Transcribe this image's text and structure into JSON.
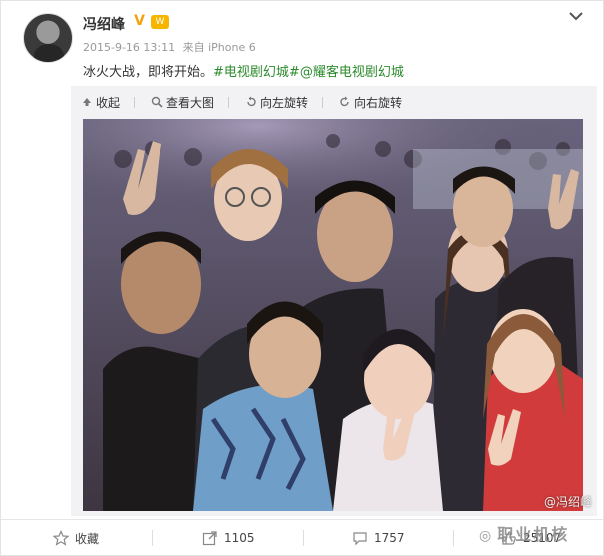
{
  "post": {
    "username": "冯绍峰",
    "verified_mark": "V",
    "level_badge": "W",
    "timestamp": "2015-9-16 13:11",
    "source": "来自 iPhone 6",
    "text_plain": "冰火大战，即将开始。",
    "tags": [
      "#电视剧幻城#",
      "@耀客电视剧幻城"
    ]
  },
  "media_toolbar": {
    "collapse": "收起",
    "view_large": "查看大图",
    "rotate_left": "向左旋转",
    "rotate_right": "向右旋转"
  },
  "photo": {
    "watermark": "@冯绍峰"
  },
  "footer": {
    "favorite_label": "收藏",
    "repost_count": "1105",
    "comment_count": "1757",
    "like_count": "25107"
  },
  "overlay": {
    "wechat_watermark": "职业机核"
  },
  "colors": {
    "tag_green": "#2b8a2b",
    "badge_gold": "#f3a20b"
  },
  "icons": [
    "avatar",
    "verified-v-icon",
    "level-badge-icon",
    "chevron-down-icon",
    "collapse-arrow-icon",
    "zoom-icon",
    "rotate-left-icon",
    "rotate-right-icon",
    "star-icon",
    "repost-icon",
    "comment-icon",
    "like-icon"
  ]
}
